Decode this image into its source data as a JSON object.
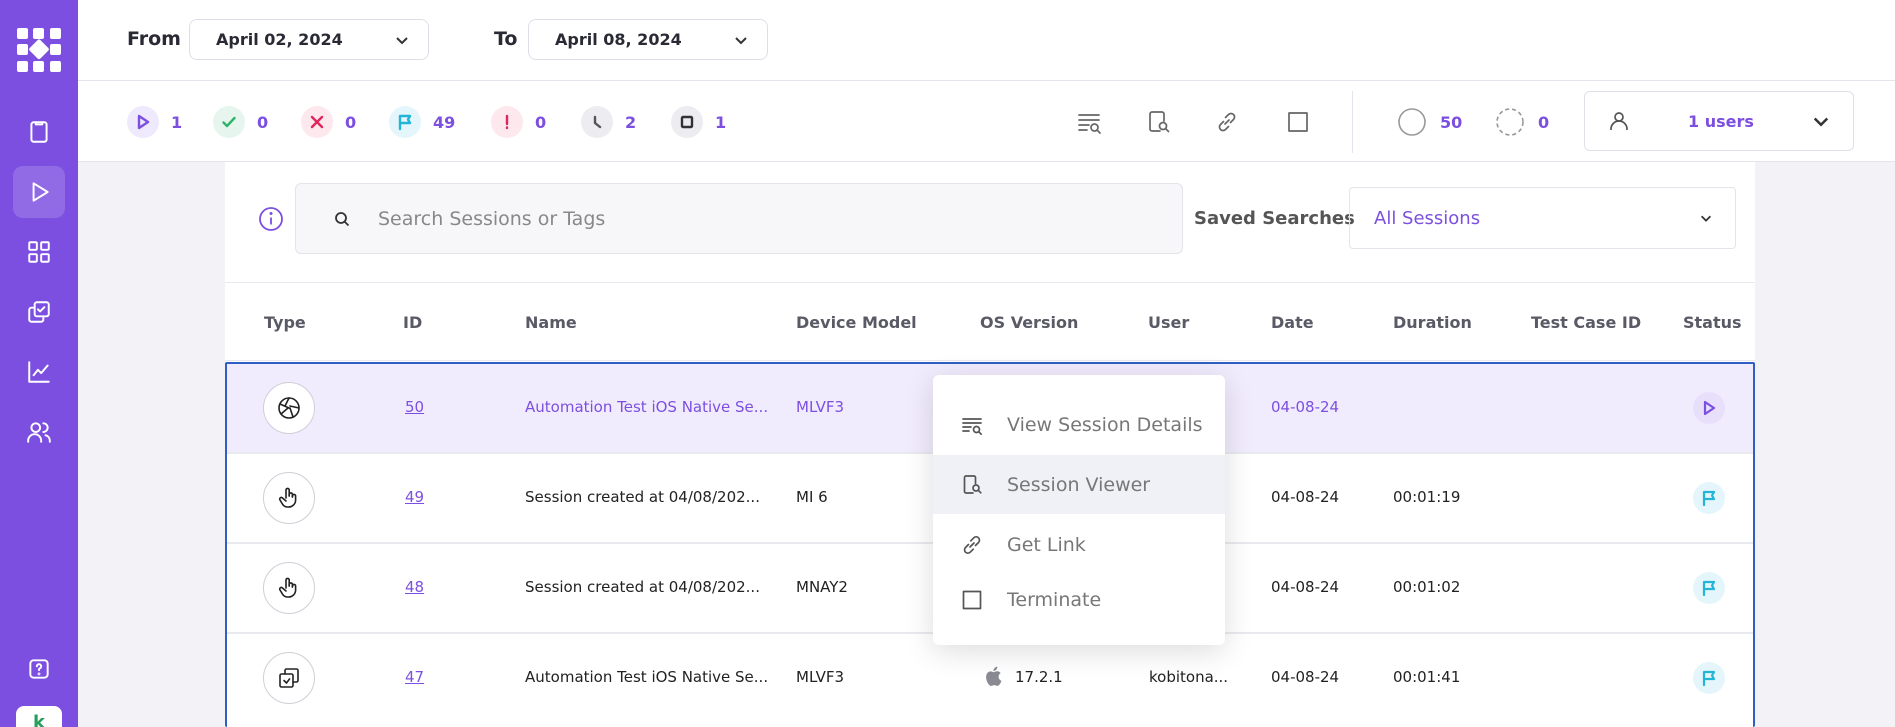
{
  "filters": {
    "from_label": "From",
    "from_value": "April 02, 2024",
    "to_label": "To",
    "to_value": "April 08, 2024"
  },
  "stats": [
    {
      "name": "running",
      "count": "1",
      "color": "#7c4fe0",
      "bg": "#eee9fc"
    },
    {
      "name": "passed",
      "count": "0",
      "color": "#2fb36b",
      "bg": "#e6f6ee"
    },
    {
      "name": "failed",
      "count": "0",
      "color": "#e0245e",
      "bg": "#fde8ee"
    },
    {
      "name": "flagged",
      "count": "49",
      "color": "#22b5d8",
      "bg": "#e4f6fb"
    },
    {
      "name": "error",
      "count": "0",
      "color": "#e0245e",
      "bg": "#fde8ee"
    },
    {
      "name": "pending",
      "count": "2",
      "color": "#555",
      "bg": "#ececf1"
    },
    {
      "name": "terminated",
      "count": "1",
      "color": "#333",
      "bg": "#ececf1"
    }
  ],
  "totals": {
    "all_count": "50",
    "empty_count": "0"
  },
  "users_select": {
    "value": "1 users"
  },
  "search": {
    "placeholder": "Search Sessions or Tags",
    "saved_label": "Saved Searches",
    "saved_value": "All Sessions"
  },
  "table": {
    "headers": [
      "Type",
      "ID",
      "Name",
      "Device Model",
      "OS Version",
      "User",
      "Date",
      "Duration",
      "Test Case ID",
      "Status"
    ],
    "rows": [
      {
        "type_icon": "aperture-icon",
        "id": "50",
        "name": "Automation Test iOS Native Se...",
        "device": "MLVF3",
        "os": "",
        "user": "",
        "date": "04-08-24",
        "duration": "",
        "test_case": "",
        "status": "running"
      },
      {
        "type_icon": "hand-pointer-icon",
        "id": "49",
        "name": "Session created at 04/08/202...",
        "device": "MI 6",
        "os": "",
        "user": "",
        "date": "04-08-24",
        "duration": "00:01:19",
        "test_case": "",
        "status": "flagged"
      },
      {
        "type_icon": "hand-pointer-icon",
        "id": "48",
        "name": "Session created at 04/08/202...",
        "device": "MNAY2",
        "os": "",
        "user": "",
        "date": "04-08-24",
        "duration": "00:01:02",
        "test_case": "",
        "status": "flagged"
      },
      {
        "type_icon": "automation-icon",
        "id": "47",
        "name": "Automation Test iOS Native Se...",
        "device": "MLVF3",
        "os": "17.2.1",
        "user": "kobitona...",
        "date": "04-08-24",
        "duration": "00:01:41",
        "test_case": "",
        "status": "flagged"
      }
    ]
  },
  "context_menu": {
    "items": [
      {
        "label": "View Session Details",
        "icon": "details-icon"
      },
      {
        "label": "Session Viewer",
        "icon": "device-viewer-icon"
      },
      {
        "label": "Get Link",
        "icon": "link-icon"
      },
      {
        "label": "Terminate",
        "icon": "square-icon"
      }
    ]
  },
  "colors": {
    "brand": "#7c4fe0",
    "row_highlight": "#f1ecfd",
    "selection_border": "#2f5fc4"
  }
}
